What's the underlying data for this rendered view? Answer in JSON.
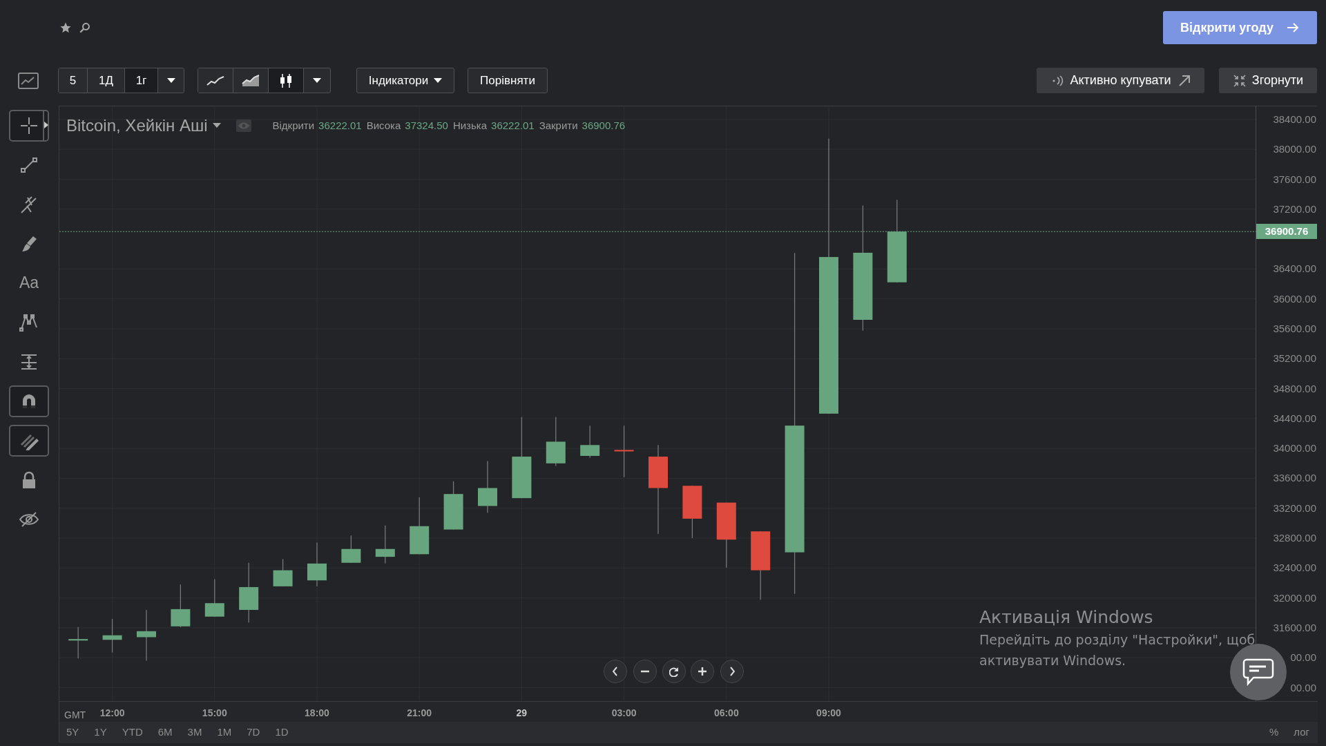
{
  "header": {
    "open_deal_button": "Відкрити угоду"
  },
  "toolbar": {
    "intervals": [
      {
        "label": "5",
        "selected": false
      },
      {
        "label": "1Д",
        "selected": false
      },
      {
        "label": "1г",
        "selected": true
      }
    ],
    "chart_types": [
      {
        "kind": "line",
        "selected": false
      },
      {
        "kind": "area",
        "selected": false
      },
      {
        "kind": "candles",
        "selected": true
      }
    ],
    "indicators_button": "Індикатори",
    "compare_button": "Порівняти",
    "buy_button": "Активно купувати",
    "collapse_button": "Згорнути"
  },
  "tools": [
    {
      "kind": "crosshair",
      "on": true
    },
    {
      "kind": "trend-line",
      "on": false
    },
    {
      "kind": "pitchfork",
      "on": false
    },
    {
      "kind": "brush",
      "on": false
    },
    {
      "kind": "text",
      "label": "Aa",
      "on": false
    },
    {
      "kind": "pattern",
      "on": false
    },
    {
      "kind": "measure",
      "on": false
    },
    {
      "kind": "magnet",
      "on": true
    },
    {
      "kind": "drawing-mode",
      "on": true
    },
    {
      "kind": "lock",
      "on": false
    },
    {
      "kind": "hide",
      "on": false
    }
  ],
  "chart": {
    "title": "Bitcoin, Хейкін Аші",
    "ohlc": [
      {
        "label": "Відкрити",
        "value": "36222.01"
      },
      {
        "label": "Висока",
        "value": "37324.50"
      },
      {
        "label": "Низька",
        "value": "36222.01"
      },
      {
        "label": "Закрити",
        "value": "36900.76"
      }
    ],
    "price_axis": [
      "38400.00",
      "38000.00",
      "37600.00",
      "37200.00",
      "36400.00",
      "36000.00",
      "35600.00",
      "35200.00",
      "34800.00",
      "34400.00",
      "34000.00",
      "33600.00",
      "33200.00",
      "32800.00",
      "32400.00",
      "32000.00",
      "31600.00",
      "00.00",
      "00.00"
    ],
    "time_axis": [
      {
        "label": "12:00",
        "kind": "time"
      },
      {
        "label": "15:00",
        "kind": "time"
      },
      {
        "label": "18:00",
        "kind": "time"
      },
      {
        "label": "21:00",
        "kind": "time"
      },
      {
        "label": "29",
        "kind": "date"
      },
      {
        "label": "03:00",
        "kind": "time"
      },
      {
        "label": "06:00",
        "kind": "time"
      },
      {
        "label": "09:00",
        "kind": "time"
      }
    ],
    "price_badge": "36900.76",
    "timezone": "GMT",
    "ranges": [
      "5Y",
      "1Y",
      "YTD",
      "6M",
      "3M",
      "1M",
      "7D",
      "1D"
    ],
    "percent_toggle": "%",
    "log_toggle": "лог"
  },
  "os_notice": {
    "title": "Активація Windows",
    "text": "Перейдіть до розділу \"Настройки\", щоб активувати Windows."
  }
}
